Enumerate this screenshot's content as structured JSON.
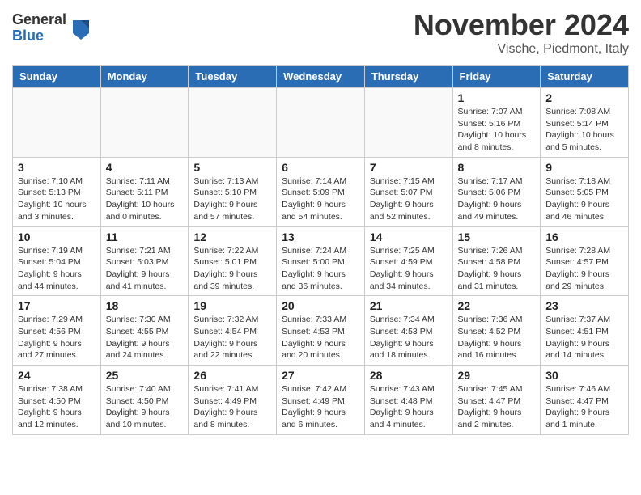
{
  "header": {
    "logo_general": "General",
    "logo_blue": "Blue",
    "month_title": "November 2024",
    "location": "Vische, Piedmont, Italy"
  },
  "days_of_week": [
    "Sunday",
    "Monday",
    "Tuesday",
    "Wednesday",
    "Thursday",
    "Friday",
    "Saturday"
  ],
  "weeks": [
    [
      {
        "day": "",
        "info": ""
      },
      {
        "day": "",
        "info": ""
      },
      {
        "day": "",
        "info": ""
      },
      {
        "day": "",
        "info": ""
      },
      {
        "day": "",
        "info": ""
      },
      {
        "day": "1",
        "info": "Sunrise: 7:07 AM\nSunset: 5:16 PM\nDaylight: 10 hours and 8 minutes."
      },
      {
        "day": "2",
        "info": "Sunrise: 7:08 AM\nSunset: 5:14 PM\nDaylight: 10 hours and 5 minutes."
      }
    ],
    [
      {
        "day": "3",
        "info": "Sunrise: 7:10 AM\nSunset: 5:13 PM\nDaylight: 10 hours and 3 minutes."
      },
      {
        "day": "4",
        "info": "Sunrise: 7:11 AM\nSunset: 5:11 PM\nDaylight: 10 hours and 0 minutes."
      },
      {
        "day": "5",
        "info": "Sunrise: 7:13 AM\nSunset: 5:10 PM\nDaylight: 9 hours and 57 minutes."
      },
      {
        "day": "6",
        "info": "Sunrise: 7:14 AM\nSunset: 5:09 PM\nDaylight: 9 hours and 54 minutes."
      },
      {
        "day": "7",
        "info": "Sunrise: 7:15 AM\nSunset: 5:07 PM\nDaylight: 9 hours and 52 minutes."
      },
      {
        "day": "8",
        "info": "Sunrise: 7:17 AM\nSunset: 5:06 PM\nDaylight: 9 hours and 49 minutes."
      },
      {
        "day": "9",
        "info": "Sunrise: 7:18 AM\nSunset: 5:05 PM\nDaylight: 9 hours and 46 minutes."
      }
    ],
    [
      {
        "day": "10",
        "info": "Sunrise: 7:19 AM\nSunset: 5:04 PM\nDaylight: 9 hours and 44 minutes."
      },
      {
        "day": "11",
        "info": "Sunrise: 7:21 AM\nSunset: 5:03 PM\nDaylight: 9 hours and 41 minutes."
      },
      {
        "day": "12",
        "info": "Sunrise: 7:22 AM\nSunset: 5:01 PM\nDaylight: 9 hours and 39 minutes."
      },
      {
        "day": "13",
        "info": "Sunrise: 7:24 AM\nSunset: 5:00 PM\nDaylight: 9 hours and 36 minutes."
      },
      {
        "day": "14",
        "info": "Sunrise: 7:25 AM\nSunset: 4:59 PM\nDaylight: 9 hours and 34 minutes."
      },
      {
        "day": "15",
        "info": "Sunrise: 7:26 AM\nSunset: 4:58 PM\nDaylight: 9 hours and 31 minutes."
      },
      {
        "day": "16",
        "info": "Sunrise: 7:28 AM\nSunset: 4:57 PM\nDaylight: 9 hours and 29 minutes."
      }
    ],
    [
      {
        "day": "17",
        "info": "Sunrise: 7:29 AM\nSunset: 4:56 PM\nDaylight: 9 hours and 27 minutes."
      },
      {
        "day": "18",
        "info": "Sunrise: 7:30 AM\nSunset: 4:55 PM\nDaylight: 9 hours and 24 minutes."
      },
      {
        "day": "19",
        "info": "Sunrise: 7:32 AM\nSunset: 4:54 PM\nDaylight: 9 hours and 22 minutes."
      },
      {
        "day": "20",
        "info": "Sunrise: 7:33 AM\nSunset: 4:53 PM\nDaylight: 9 hours and 20 minutes."
      },
      {
        "day": "21",
        "info": "Sunrise: 7:34 AM\nSunset: 4:53 PM\nDaylight: 9 hours and 18 minutes."
      },
      {
        "day": "22",
        "info": "Sunrise: 7:36 AM\nSunset: 4:52 PM\nDaylight: 9 hours and 16 minutes."
      },
      {
        "day": "23",
        "info": "Sunrise: 7:37 AM\nSunset: 4:51 PM\nDaylight: 9 hours and 14 minutes."
      }
    ],
    [
      {
        "day": "24",
        "info": "Sunrise: 7:38 AM\nSunset: 4:50 PM\nDaylight: 9 hours and 12 minutes."
      },
      {
        "day": "25",
        "info": "Sunrise: 7:40 AM\nSunset: 4:50 PM\nDaylight: 9 hours and 10 minutes."
      },
      {
        "day": "26",
        "info": "Sunrise: 7:41 AM\nSunset: 4:49 PM\nDaylight: 9 hours and 8 minutes."
      },
      {
        "day": "27",
        "info": "Sunrise: 7:42 AM\nSunset: 4:49 PM\nDaylight: 9 hours and 6 minutes."
      },
      {
        "day": "28",
        "info": "Sunrise: 7:43 AM\nSunset: 4:48 PM\nDaylight: 9 hours and 4 minutes."
      },
      {
        "day": "29",
        "info": "Sunrise: 7:45 AM\nSunset: 4:47 PM\nDaylight: 9 hours and 2 minutes."
      },
      {
        "day": "30",
        "info": "Sunrise: 7:46 AM\nSunset: 4:47 PM\nDaylight: 9 hours and 1 minute."
      }
    ]
  ]
}
